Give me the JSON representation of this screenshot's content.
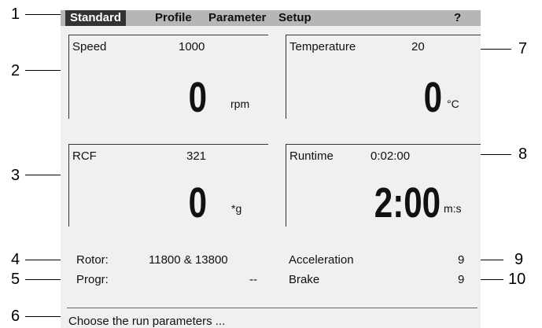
{
  "callouts": [
    "1",
    "2",
    "3",
    "4",
    "5",
    "6",
    "7",
    "8",
    "9",
    "10"
  ],
  "menu": {
    "tabs": [
      {
        "label": "Standard",
        "active": true
      },
      {
        "label": "Profile",
        "active": false
      },
      {
        "label": "Parameter",
        "active": false
      },
      {
        "label": "Setup",
        "active": false
      },
      {
        "label": "?",
        "active": false
      }
    ]
  },
  "panels": {
    "speed": {
      "label": "Speed",
      "setpoint": "1000",
      "value": "0",
      "unit": "rpm"
    },
    "temperature": {
      "label": "Temperature",
      "setpoint": "20",
      "value": "0",
      "unit": "°C"
    },
    "rcf": {
      "label": "RCF",
      "setpoint": "321",
      "value": "0",
      "unit": "*g"
    },
    "runtime": {
      "label": "Runtime",
      "setpoint": "0:02:00",
      "value": "2:00",
      "unit": "m:s"
    }
  },
  "info": {
    "rotor_label": "Rotor:",
    "rotor_value": "11800 & 13800",
    "progr_label": "Progr:",
    "progr_value": "--",
    "accel_label": "Acceleration",
    "accel_value": "9",
    "brake_label": "Brake",
    "brake_value": "9"
  },
  "status": {
    "text": "Choose the run parameters ..."
  },
  "colors": {
    "screen_bg": "#f0f0ee",
    "menubar_bg": "#b6b6b6",
    "active_tab_bg": "#333333"
  }
}
